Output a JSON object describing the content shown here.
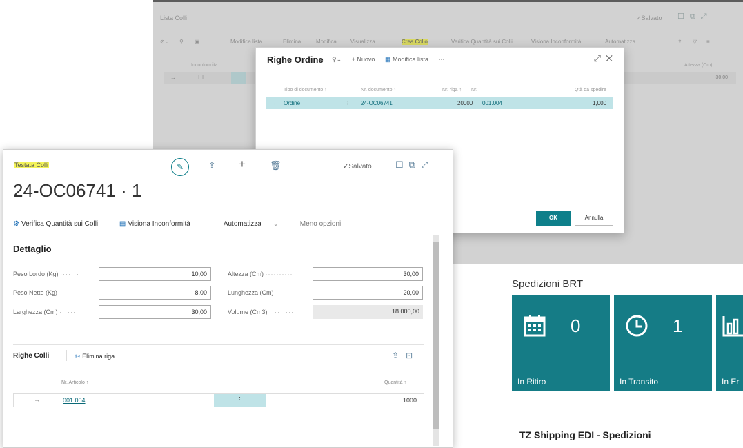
{
  "background_window": {
    "title": "Lista Colli",
    "saved_label": "✓Salvato",
    "toolbar": [
      "Modifica lista",
      "Elimina",
      "Modifica",
      "Visualizza",
      "Crea Collo",
      "Verifica Quantità sui Colli",
      "Visiona Inconformità",
      "Automatizza"
    ],
    "grid_headers": [
      "Inconformita",
      "Altezza (Cm)"
    ],
    "grid_row_value": "30,00"
  },
  "dialog": {
    "title": "Righe Ordine",
    "new_label": "+ Nuovo",
    "edit_list_label": "Modifica lista",
    "columns": [
      "Tipo di documento ↑",
      "Nr. documento ↑",
      "Nr. riga ↑",
      "Nr.",
      "Qtà da spedire"
    ],
    "row": {
      "tipo": "Ordine",
      "documento": "24-OC06741",
      "riga": "20000",
      "nr": "001.004",
      "qta": "1,000"
    },
    "ok_label": "OK",
    "cancel_label": "Annulla"
  },
  "card": {
    "caption": "Testata Colli",
    "saved_label": "✓Salvato",
    "doc_number": "24-OC06741 · 1",
    "actions": {
      "verifica": "Verifica Quantità sui Colli",
      "visiona": "Visiona Inconformità",
      "automatizza": "Automatizza",
      "meno": "Meno opzioni"
    },
    "section_title": "Dettaglio",
    "fields": {
      "peso_lordo": {
        "label": "Peso Lordo (Kg)",
        "value": "10,00"
      },
      "peso_netto": {
        "label": "Peso Netto (Kg)",
        "value": "8,00"
      },
      "larghezza": {
        "label": "Larghezza (Cm)",
        "value": "30,00"
      },
      "altezza": {
        "label": "Altezza (Cm)",
        "value": "30,00"
      },
      "lunghezza": {
        "label": "Lunghezza (Cm)",
        "value": "20,00"
      },
      "volume": {
        "label": "Volume (Cm3)",
        "value": "18.000,00"
      }
    },
    "lines": {
      "title": "Righe Colli",
      "delete_label": "Elimina riga",
      "col_item": "Nr. Articolo ↑",
      "col_qty": "Quantità ↑",
      "row": {
        "item": "001.004",
        "qty": "1000"
      }
    }
  },
  "brt": {
    "title": "Spedizioni BRT",
    "tiles": [
      {
        "label": "In Ritiro",
        "value": "0",
        "icon": "calendar-icon"
      },
      {
        "label": "In Transito",
        "value": "1",
        "icon": "clock-icon"
      },
      {
        "label": "In Er",
        "icon": "bar-chart-icon"
      }
    ]
  },
  "edi_title": "TZ Shipping EDI - Spedizioni"
}
